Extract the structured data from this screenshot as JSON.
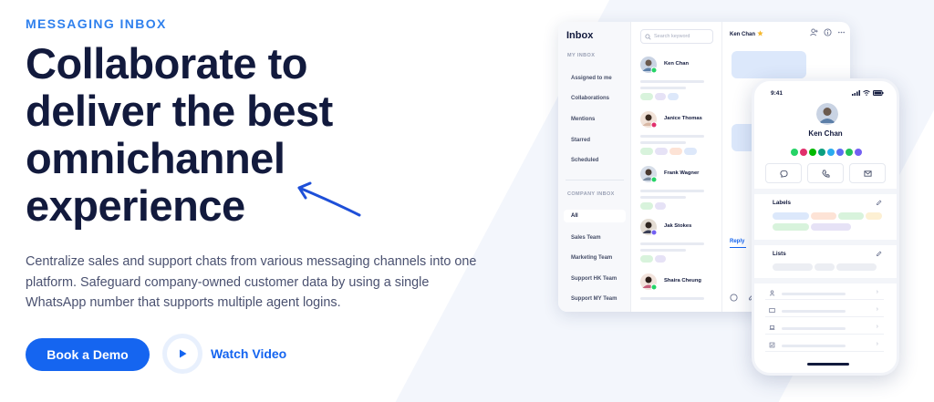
{
  "hero": {
    "eyebrow": "MESSAGING INBOX",
    "headline_lines": [
      "Collaborate to",
      "deliver the best",
      "omnichannel",
      "experience"
    ],
    "description": "Centralize sales and support chats from various messaging channels into one platform. Safeguard company-owned customer data by using a single WhatsApp number that supports multiple agent logins.",
    "primary_cta": "Book a Demo",
    "secondary_cta": "Watch Video"
  },
  "inbox": {
    "title": "Inbox",
    "my_inbox_label": "MY INBOX",
    "my_inbox_items": [
      "Assigned to me",
      "Collaborations",
      "Mentions",
      "Starred",
      "Scheduled"
    ],
    "company_inbox_label": "COMPANY INBOX",
    "company_inbox_items": [
      "All",
      "Sales Team",
      "Marketing Team",
      "Support HK Team",
      "Support MY Team"
    ],
    "search_placeholder": "Search keyword",
    "conversations": [
      {
        "name": "Ken Chan"
      },
      {
        "name": "Janice Thomas"
      },
      {
        "name": "Frank Wagner"
      },
      {
        "name": "Jak Stokes"
      },
      {
        "name": "Shaira Cheung"
      }
    ],
    "chat_header": "Ken Chan",
    "reply_label": "Reply"
  },
  "phone": {
    "time": "9:41",
    "contact_name": "Ken Chan",
    "labels_title": "Labels",
    "lists_title": "Lists"
  },
  "colors": {
    "primary": "#1565f0",
    "eyebrow": "#2f80ed",
    "headline": "#121a3d",
    "body_text": "#4a5170",
    "accent_bg": "#dce8fb"
  },
  "icons": {
    "search": "search-icon",
    "play": "play-icon",
    "arrow": "hand-drawn-arrow-icon",
    "star": "star-icon"
  }
}
